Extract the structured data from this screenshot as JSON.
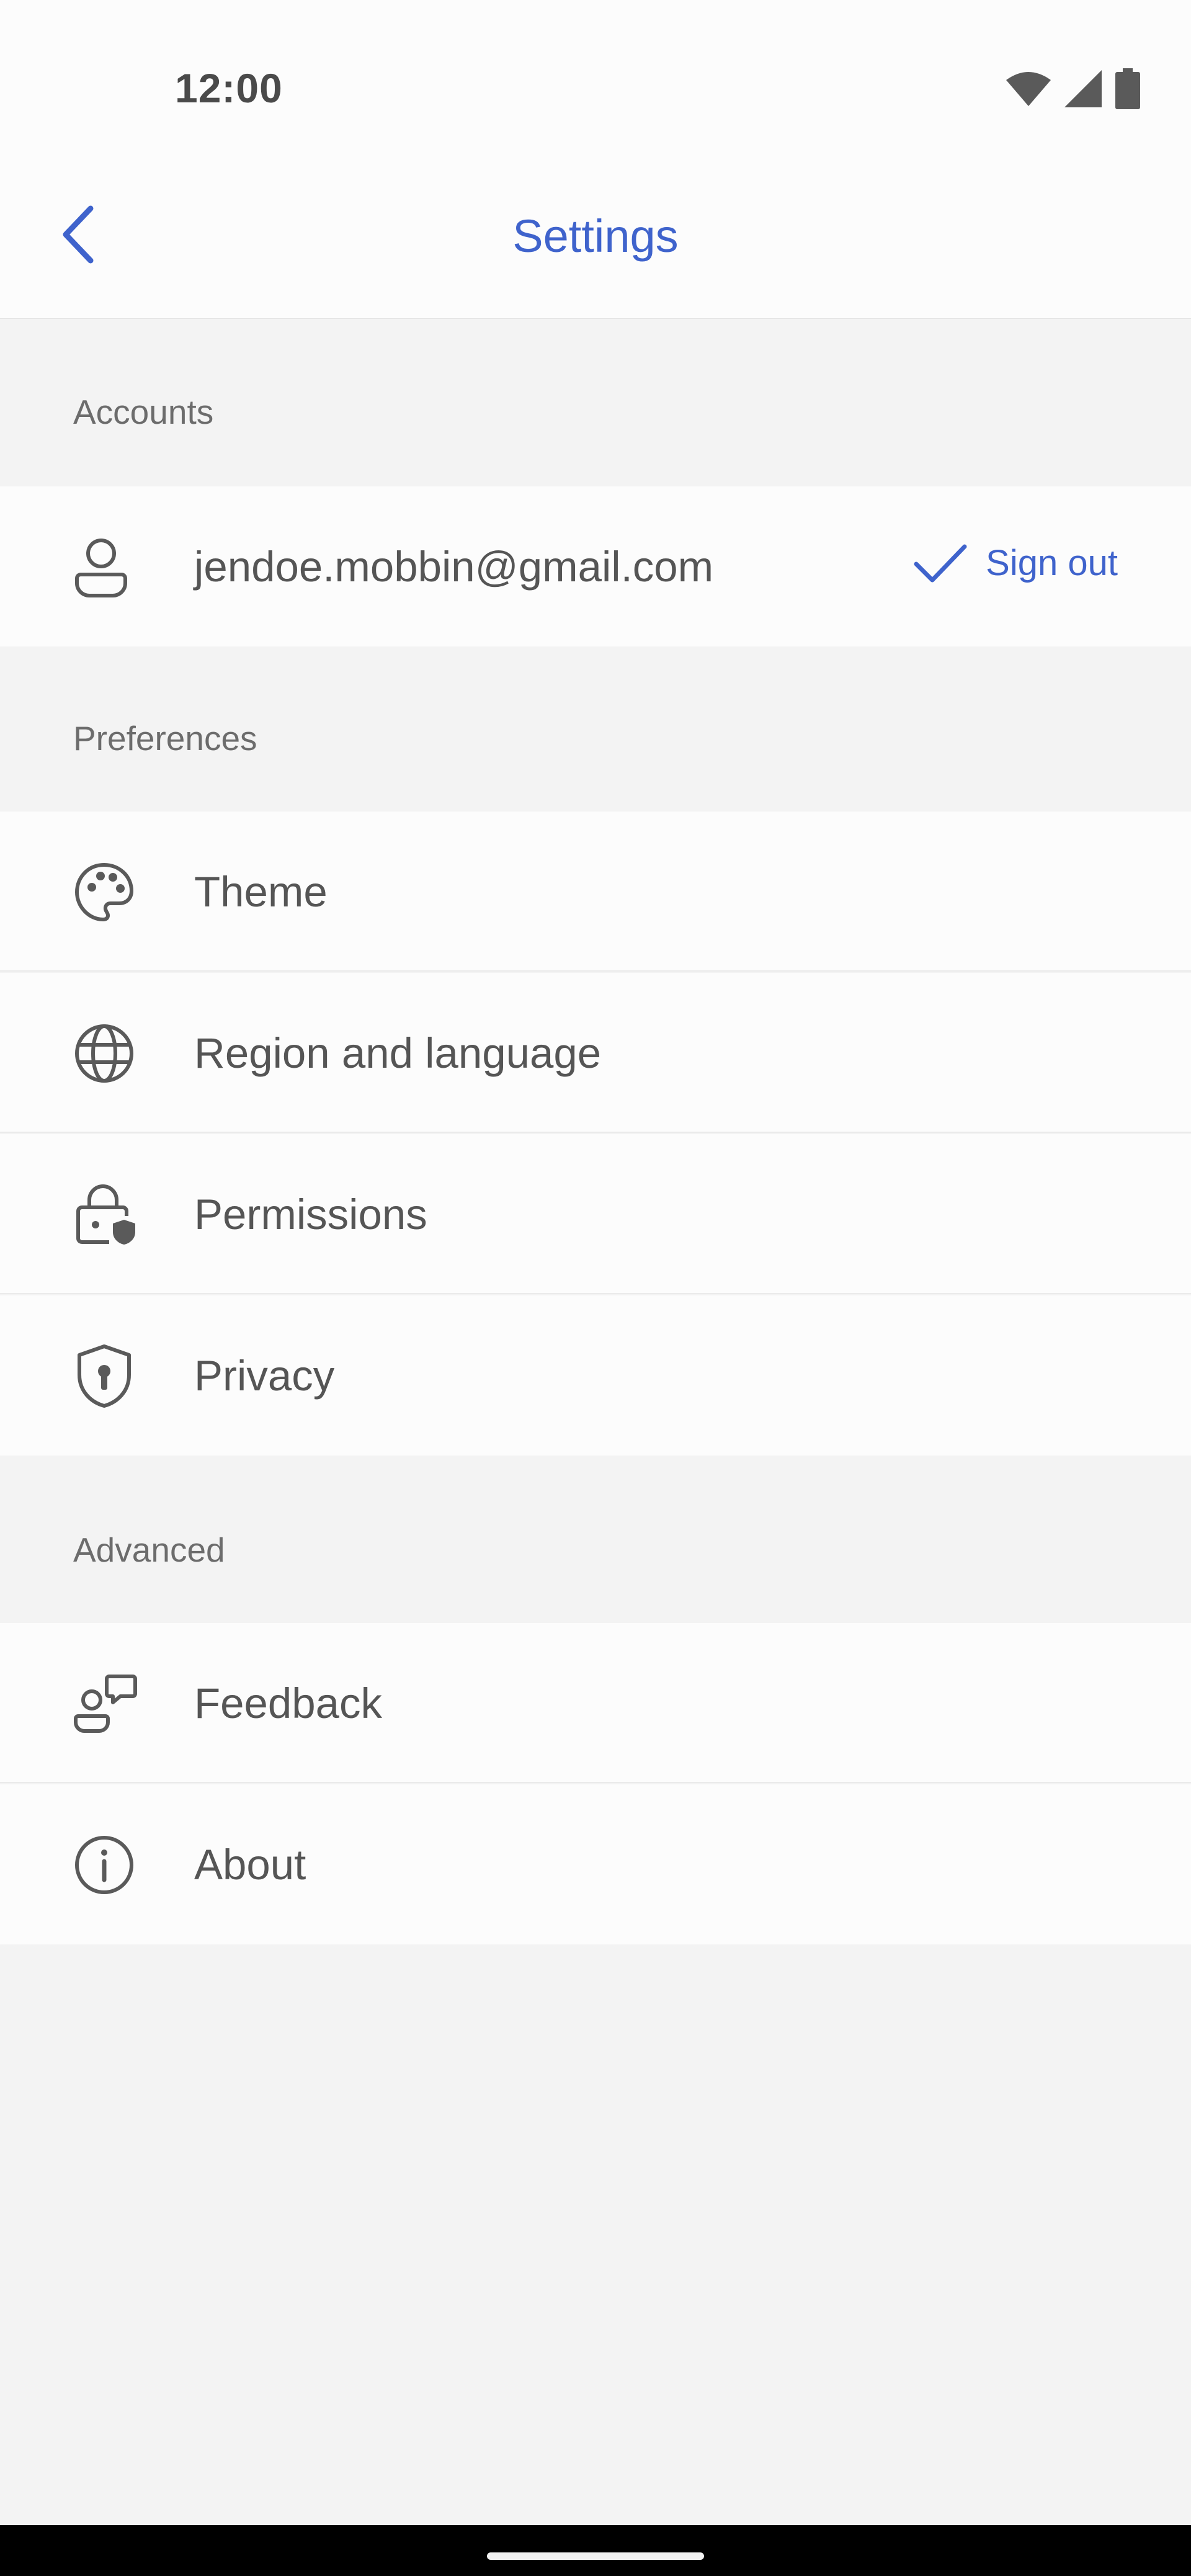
{
  "status_bar": {
    "time": "12:00",
    "icons": [
      "wifi-icon",
      "signal-icon",
      "battery-icon"
    ]
  },
  "app_bar": {
    "title": "Settings",
    "back_icon": "chevron-left-icon"
  },
  "sections": {
    "accounts": {
      "title": "Accounts",
      "email": "jendoe.mobbin@gmail.com",
      "icon": "person-icon",
      "sign_out_label": "Sign out",
      "sign_out_icon": "checkmark-icon"
    },
    "preferences": {
      "title": "Preferences",
      "items": [
        {
          "label": "Theme",
          "icon": "palette-icon"
        },
        {
          "label": "Region and language",
          "icon": "globe-icon"
        },
        {
          "label": "Permissions",
          "icon": "lock-shield-icon"
        },
        {
          "label": "Privacy",
          "icon": "shield-keyhole-icon"
        }
      ]
    },
    "advanced": {
      "title": "Advanced",
      "items": [
        {
          "label": "Feedback",
          "icon": "person-feedback-icon"
        },
        {
          "label": "About",
          "icon": "info-icon"
        }
      ]
    }
  },
  "colors": {
    "accent": "#3f63cc",
    "background": "#f3f3f3",
    "surface": "#fcfcfc",
    "text": "#555555",
    "header_text": "#6c6c6c"
  }
}
